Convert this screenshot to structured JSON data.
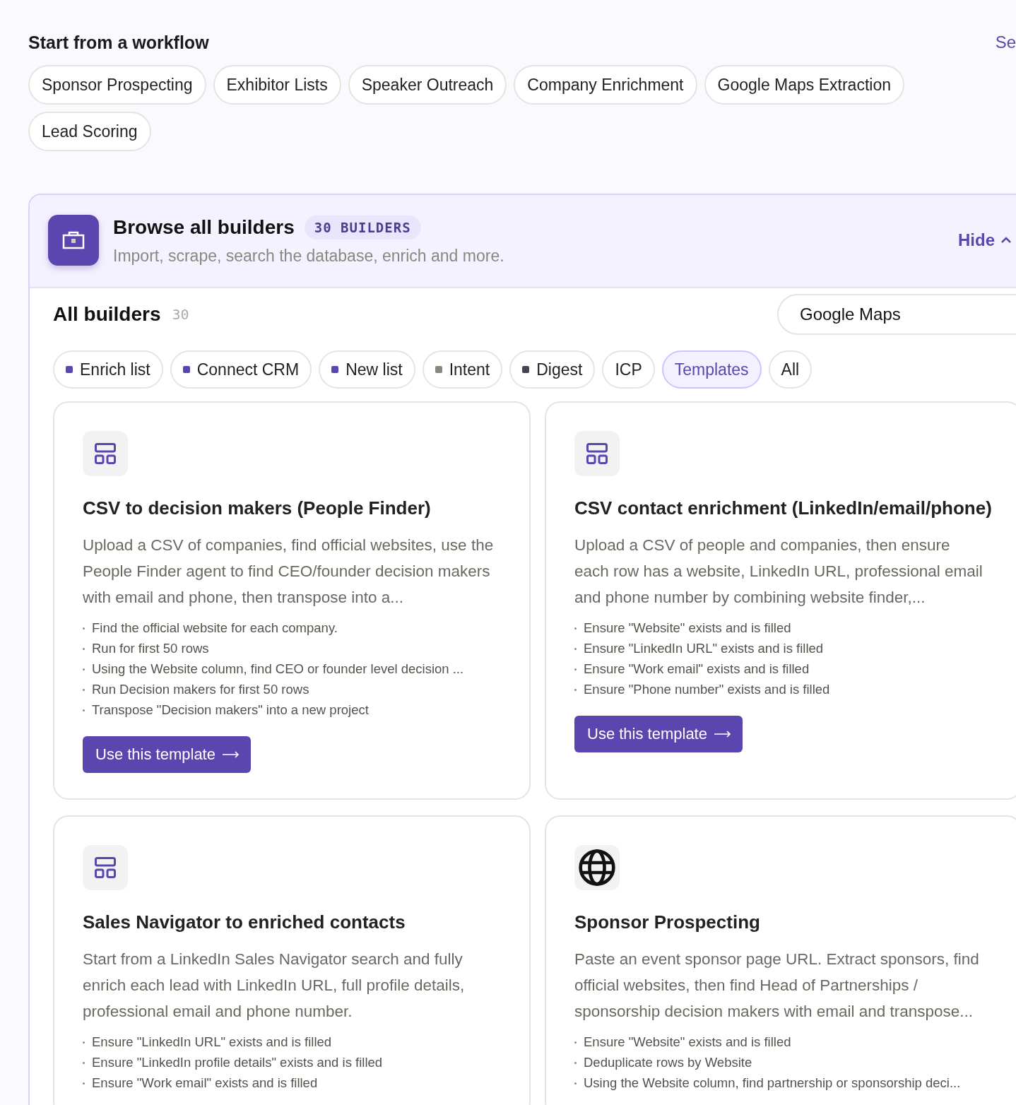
{
  "workflows": {
    "title": "Start from a workflow",
    "link": "Se",
    "chips": [
      "Sponsor Prospecting",
      "Exhibitor Lists",
      "Speaker Outreach",
      "Company Enrichment",
      "Google Maps Extraction",
      "Lead Scoring"
    ]
  },
  "browser": {
    "title": "Browse all builders",
    "badge": "30 BUILDERS",
    "subtitle": "Import, scrape, search the database, enrich and more.",
    "toggle": "Hide"
  },
  "list": {
    "title": "All builders",
    "count": "30",
    "search": {
      "value": "Google Maps"
    },
    "filters": [
      {
        "label": "Enrich list",
        "color": "#5b46b0",
        "selected": false
      },
      {
        "label": "Connect CRM",
        "color": "#5b46b0",
        "selected": false
      },
      {
        "label": "New list",
        "color": "#5b46b0",
        "selected": false
      },
      {
        "label": "Intent",
        "color": "#8a8780",
        "selected": false
      },
      {
        "label": "Digest",
        "color": "#454654",
        "selected": false
      },
      {
        "label": "ICP",
        "selected": false
      },
      {
        "label": "Templates",
        "selected": true
      },
      {
        "label": "All",
        "selected": false
      }
    ],
    "cards": [
      {
        "kind": "layout",
        "title": "CSV to decision makers (People Finder)",
        "description": "Upload a CSV of companies, find official websites, use the People Finder agent to find CEO/founder decision makers with email and phone, then transpose into a...",
        "steps": [
          "Find the official website for each company.",
          "Run for first 50 rows",
          "Using the Website column, find CEO or founder level decision ...",
          "Run Decision makers for first 50 rows",
          "Transpose \"Decision makers\" into a new project"
        ],
        "button": "Use this template"
      },
      {
        "kind": "layout",
        "title": "CSV contact enrichment (LinkedIn/email/phone)",
        "description": "Upload a CSV of people and companies, then ensure each row has a website, LinkedIn URL, professional email and phone number by combining website finder,...",
        "steps": [
          "Ensure \"Website\" exists and is filled",
          "Ensure \"LinkedIn URL\" exists and is filled",
          "Ensure \"Work email\" exists and is filled",
          "Ensure \"Phone number\" exists and is filled"
        ],
        "button": "Use this template"
      },
      {
        "kind": "layout",
        "title": "Sales Navigator to enriched contacts",
        "description": "Start from a LinkedIn Sales Navigator search and fully enrich each lead with LinkedIn URL, full profile details, professional email and phone number.",
        "steps": [
          "Ensure \"LinkedIn URL\" exists and is filled",
          "Ensure \"LinkedIn profile details\" exists and is filled",
          "Ensure \"Work email\" exists and is filled"
        ]
      },
      {
        "kind": "globe",
        "title": "Sponsor Prospecting",
        "description": "Paste an event sponsor page URL. Extract sponsors, find official websites, then find Head of Partnerships / sponsorship decision makers with email and transpose...",
        "steps": [
          "Ensure \"Website\" exists and is filled",
          "Deduplicate rows by Website",
          "Using the Website column, find partnership or sponsorship deci..."
        ]
      }
    ]
  }
}
